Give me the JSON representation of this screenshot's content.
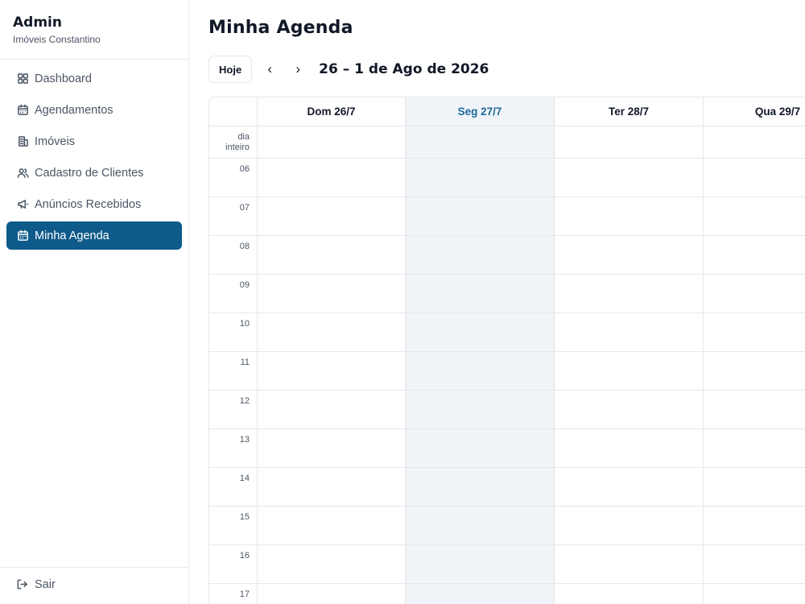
{
  "sidebar": {
    "title": "Admin",
    "subtitle": "Imóveis Constantino",
    "items": [
      {
        "label": "Dashboard",
        "icon": "dashboard-icon"
      },
      {
        "label": "Agendamentos",
        "icon": "calendar-icon"
      },
      {
        "label": "Imóveis",
        "icon": "building-icon"
      },
      {
        "label": "Cadastro de Clientes",
        "icon": "users-icon"
      },
      {
        "label": "Anúncios Recebidos",
        "icon": "megaphone-icon"
      },
      {
        "label": "Minha Agenda",
        "icon": "calendar-icon",
        "active": true
      }
    ],
    "logout_label": "Sair"
  },
  "main": {
    "title": "Minha Agenda",
    "today_label": "Hoje",
    "prev_label": "‹",
    "next_label": "›",
    "range_label": "26 – 1 de Ago de 2026"
  },
  "calendar": {
    "days": [
      {
        "label": "Dom 26/7",
        "today": false
      },
      {
        "label": "Seg 27/7",
        "today": true
      },
      {
        "label": "Ter 28/7",
        "today": false
      },
      {
        "label": "Qua 29/7",
        "today": false
      }
    ],
    "allday_label_line1": "dia",
    "allday_label_line2": "inteiro",
    "hours": [
      "06",
      "07",
      "08",
      "09",
      "10",
      "11",
      "12",
      "13",
      "14",
      "15",
      "16",
      "17"
    ]
  },
  "colors": {
    "accent": "#0e5a8a",
    "today_bg": "#f0f4f8",
    "today_text": "#1f6a99",
    "border": "#e5e7eb"
  }
}
